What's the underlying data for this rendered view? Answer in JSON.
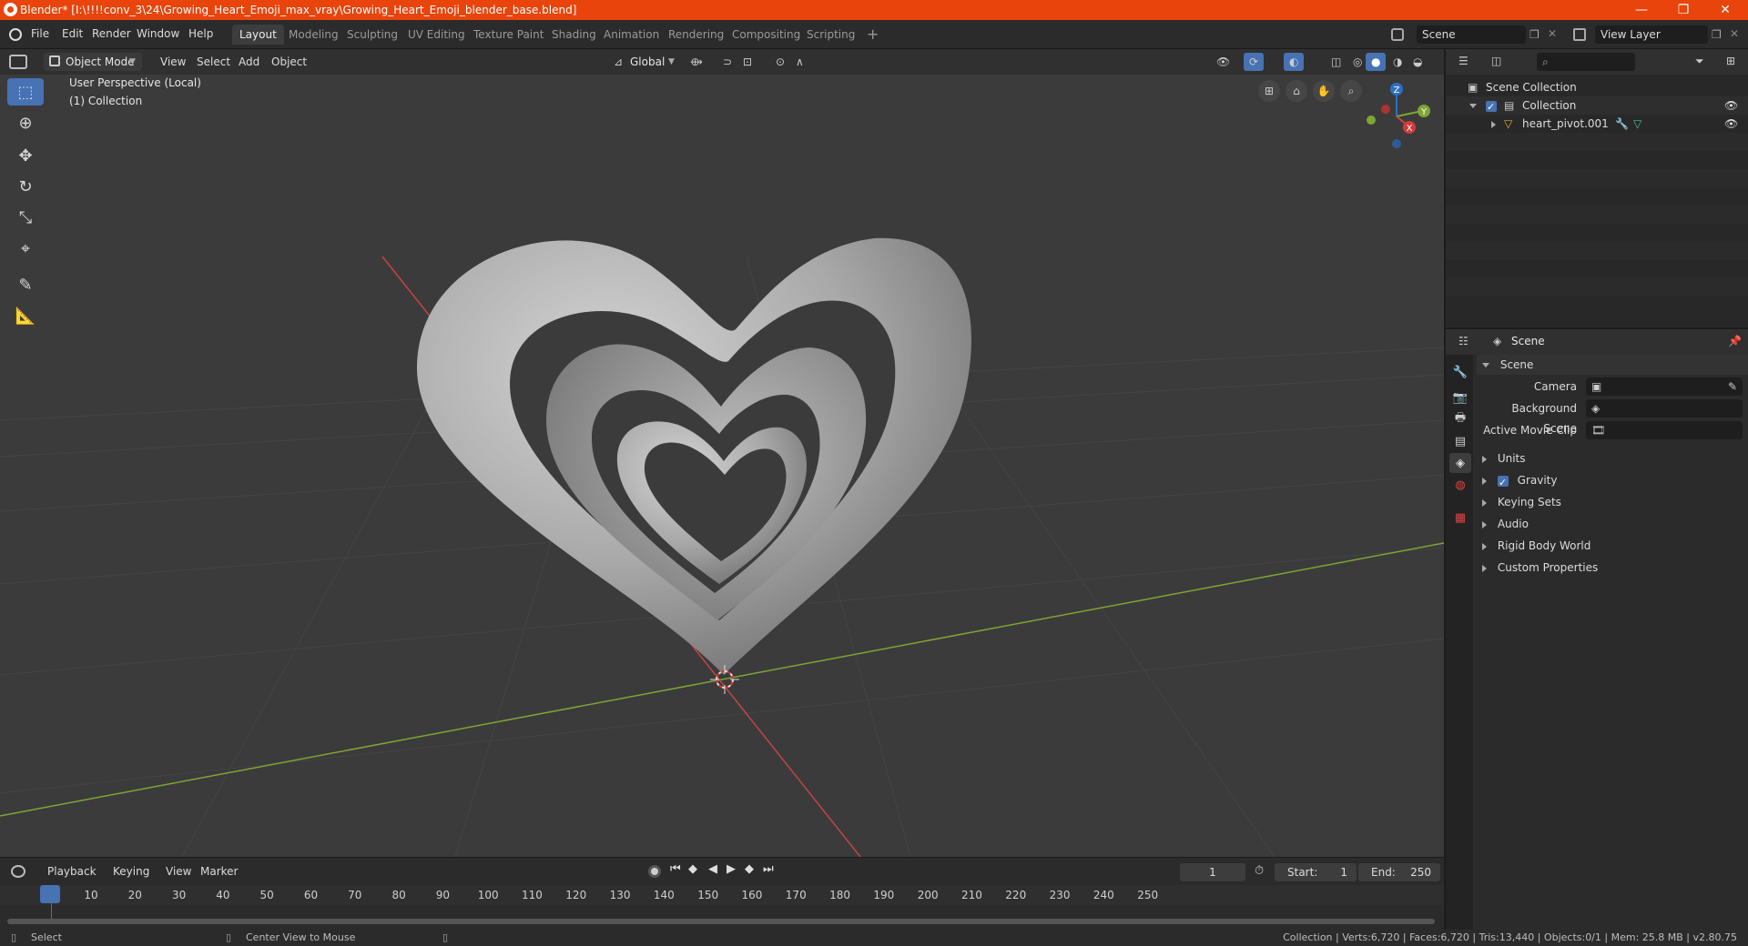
{
  "window": {
    "title": "Blender* [I:\\!!!!conv_3\\24\\Growing_Heart_Emoji_max_vray\\Growing_Heart_Emoji_blender_base.blend]",
    "minimize": "—",
    "maximize": "❐",
    "close": "✕"
  },
  "menu": [
    "File",
    "Edit",
    "Render",
    "Window",
    "Help"
  ],
  "workspaces": [
    "Layout",
    "Modeling",
    "Sculpting",
    "UV Editing",
    "Texture Paint",
    "Shading",
    "Animation",
    "Rendering",
    "Compositing",
    "Scripting"
  ],
  "active_workspace": "Layout",
  "scene_field": "Scene",
  "view_layer_field": "View Layer",
  "viewport_header": {
    "mode": "Object Mode",
    "view": "View",
    "select": "Select",
    "add": "Add",
    "object": "Object",
    "transform": "Global"
  },
  "viewport": {
    "perspective": "User Perspective (Local)",
    "collection": "(1) Collection",
    "gizmo": {
      "z": "Z",
      "y": "Y",
      "x": "X"
    }
  },
  "timeline": {
    "playback": "Playback",
    "keying": "Keying",
    "view": "View",
    "marker": "Marker",
    "current_frame": "1",
    "start_label": "Start:",
    "start": "1",
    "end_label": "End:",
    "end": "250",
    "ruler": [
      "1",
      "10",
      "20",
      "30",
      "40",
      "50",
      "60",
      "70",
      "80",
      "90",
      "100",
      "110",
      "120",
      "130",
      "140",
      "150",
      "160",
      "170",
      "180",
      "190",
      "200",
      "210",
      "220",
      "230",
      "240",
      "250"
    ]
  },
  "status": {
    "left": "Select",
    "middle": "Center View to Mouse",
    "right": "Collection | Verts:6,720 | Faces:6,720 | Tris:13,440 | Objects:0/1 | Mem: 25.8 MB | v2.80.75"
  },
  "outliner": {
    "root": "Scene Collection",
    "collection": "Collection",
    "object": "heart_pivot.001"
  },
  "properties": {
    "header": "Scene",
    "section": "Scene",
    "camera_label": "Camera",
    "background_label": "Background Scene",
    "movie_label": "Active Movie Clip",
    "panels": [
      "Units",
      "Gravity",
      "Keying Sets",
      "Audio",
      "Rigid Body World",
      "Custom Properties"
    ]
  },
  "colors": {
    "titlebar": "#e8440c",
    "accent": "#4772b3",
    "viewport_bg": "#3b3b3b",
    "x_axis": "#c44545",
    "y_axis": "#7fa534"
  }
}
